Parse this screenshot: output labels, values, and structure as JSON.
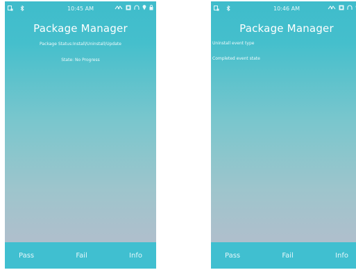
{
  "screens": [
    {
      "status": {
        "time": "10:45 AM"
      },
      "title": "Package Manager",
      "lines": [
        "Package Status:Install/Uninstall/Update",
        "State: No Progress"
      ],
      "buttons": {
        "pass": "Pass",
        "fail": "Fail",
        "info": "Info"
      }
    },
    {
      "status": {
        "time": "10:46 AM"
      },
      "title": "Package Manager",
      "lines": [
        "Uninstall event type",
        "Completed event state"
      ],
      "buttons": {
        "pass": "Pass",
        "fail": "Fail",
        "info": "Info"
      }
    }
  ],
  "icons": {
    "left": [
      "notification-icon",
      "bluetooth-icon"
    ],
    "right": [
      "transfer-icon",
      "nfc-icon",
      "headset-icon",
      "location-icon",
      "lock-icon"
    ]
  },
  "colors": {
    "accent": "#40bfd0",
    "text": "#ffffff"
  }
}
